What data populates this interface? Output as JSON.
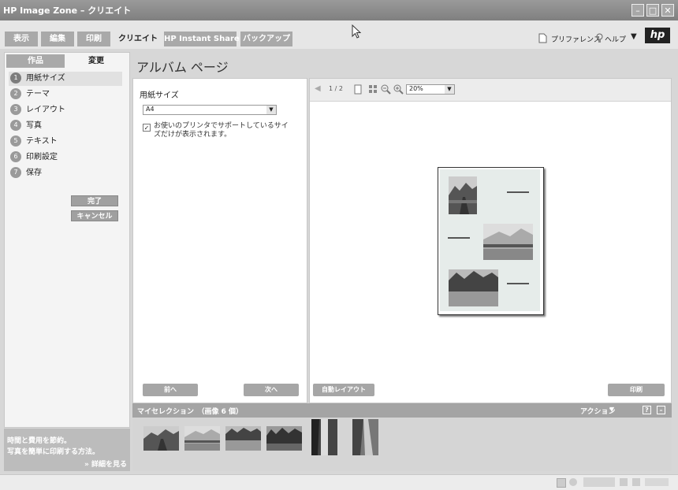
{
  "window": {
    "title": "HP Image Zone – クリエイト"
  },
  "tabs": [
    {
      "label": "表示"
    },
    {
      "label": "編集"
    },
    {
      "label": "印刷"
    },
    {
      "label": "クリエイト"
    },
    {
      "label": "HP Instant Share"
    },
    {
      "label": "バックアップ"
    }
  ],
  "header": {
    "preferences": "プリファレンス",
    "help": "ヘルプ",
    "logo": "hp"
  },
  "subtabs": {
    "works": "作品",
    "change": "変更"
  },
  "steps": [
    {
      "num": "1",
      "label": "用紙サイズ"
    },
    {
      "num": "2",
      "label": "テーマ"
    },
    {
      "num": "3",
      "label": "レイアウト"
    },
    {
      "num": "4",
      "label": "写真"
    },
    {
      "num": "5",
      "label": "テキスト"
    },
    {
      "num": "6",
      "label": "印刷設定"
    },
    {
      "num": "7",
      "label": "保存"
    }
  ],
  "left_buttons": {
    "done": "完了",
    "cancel": "キャンセル"
  },
  "tip": {
    "line1": "時間と費用を節約。",
    "line2": "写真を簡単に印刷する方法。",
    "link": "» 詳細を見る"
  },
  "page_title": "アルバム ページ",
  "settings": {
    "paper_label": "用紙サイズ",
    "paper_value": "A4",
    "checkbox_label": "お使いのプリンタでサポートしているサイズだけが表示されます。",
    "prev": "前へ",
    "next": "次へ"
  },
  "preview": {
    "page_count": "1 / 2",
    "zoom": "20%",
    "auto_layout": "自動レイアウト",
    "print": "印刷"
  },
  "selection": {
    "label": "マイセレクション　（画像 6 個）",
    "actions": "アクション"
  }
}
